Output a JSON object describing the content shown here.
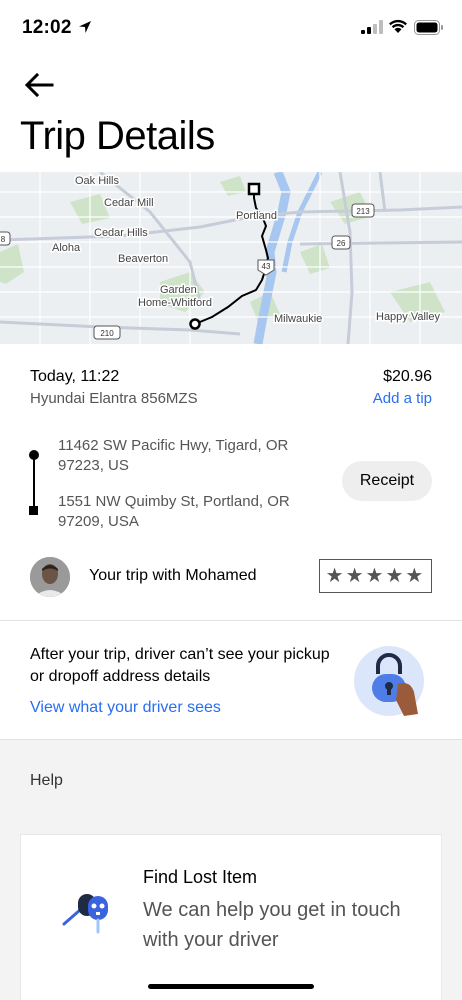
{
  "status_bar": {
    "time": "12:02"
  },
  "header": {
    "title": "Trip Details"
  },
  "map": {
    "labels": [
      "Oak Hills",
      "Cedar Mill",
      "Cedar Hills",
      "Aloha",
      "Beaverton",
      "Portland",
      "Garden",
      "Home-Whitford",
      "Milwaukie",
      "Happy Valley"
    ],
    "highway_shields": [
      "213",
      "26",
      "43",
      "210",
      "8"
    ]
  },
  "trip": {
    "date": "Today, 11:22",
    "vehicle": "Hyundai Elantra 856MZS",
    "price": "$20.96",
    "add_tip_label": "Add a tip",
    "pickup": "11462 SW Pacific Hwy, Tigard, OR 97223, US",
    "dropoff": "1551 NW Quimby St, Portland, OR 97209, USA",
    "receipt_label": "Receipt"
  },
  "driver": {
    "text": "Your trip with Mohamed",
    "rating_stars": "★★★★★"
  },
  "privacy": {
    "text": "After your trip, driver can’t see your pickup or dropoff address details",
    "link": "View what your driver sees"
  },
  "help": {
    "title": "Help",
    "card_title": "Find Lost Item",
    "card_desc": "We can help you get in touch with your driver"
  },
  "colors": {
    "link": "#276ef1",
    "muted_text": "#555555",
    "help_bg": "#f3f3f3"
  }
}
